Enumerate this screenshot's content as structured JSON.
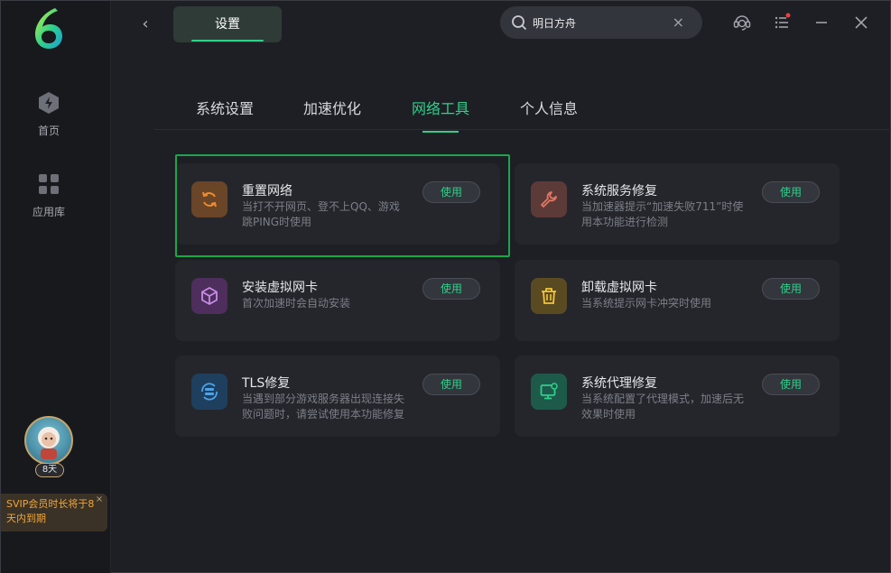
{
  "sidebar": {
    "items": [
      {
        "label": "首页",
        "icon": "home-icon"
      },
      {
        "label": "应用库",
        "icon": "apps-icon"
      }
    ],
    "membership": {
      "days": "8天",
      "tip": "SVIP会员时长将于8天内到期",
      "close": "×"
    }
  },
  "header": {
    "back": "‹",
    "title": "设置",
    "search": {
      "value": "明日方舟",
      "clear": "×"
    }
  },
  "tabs": [
    {
      "label": "系统设置",
      "active": false
    },
    {
      "label": "加速优化",
      "active": false
    },
    {
      "label": "网络工具",
      "active": true
    },
    {
      "label": "个人信息",
      "active": false
    }
  ],
  "cards": [
    {
      "title": "重置网络",
      "desc": "当打不开网页、登不上QQ、游戏跳PING时使用",
      "button": "使用",
      "icon": "refresh-icon",
      "color": "#f08a2a"
    },
    {
      "title": "系统服务修复",
      "desc": "当加速器提示“加速失败711”时使用本功能进行检测",
      "button": "使用",
      "icon": "wrench-icon",
      "color": "#e07766"
    },
    {
      "title": "安装虚拟网卡",
      "desc": "首次加速时会自动安装",
      "button": "使用",
      "icon": "cube-icon",
      "color": "#c98be8"
    },
    {
      "title": "卸载虚拟网卡",
      "desc": "当系统提示网卡冲突时使用",
      "button": "使用",
      "icon": "trash-icon",
      "color": "#f2c53a"
    },
    {
      "title": "TLS修复",
      "desc": "当遇到部分游戏服务器出现连接失败问题时，请尝试使用本功能修复",
      "button": "使用",
      "icon": "server-icon",
      "color": "#4aa3e8"
    },
    {
      "title": "系统代理修复",
      "desc": "当系统配置了代理模式，加速后无效果时使用",
      "button": "使用",
      "icon": "monitor-icon",
      "color": "#2fd08b"
    }
  ],
  "colors": {
    "accent": "#2fd08b",
    "highlight": "#1aa64a"
  }
}
